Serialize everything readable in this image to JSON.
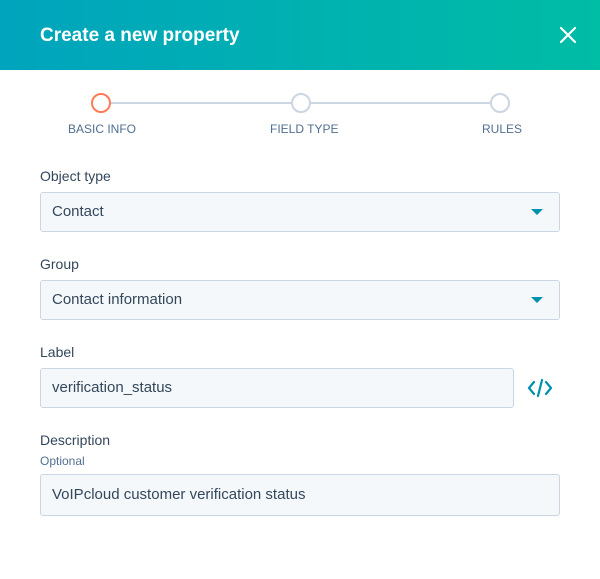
{
  "dialog": {
    "title": "Create a new property",
    "close_icon": "close-icon"
  },
  "stepper": {
    "steps": [
      {
        "label": "BASIC INFO",
        "state": "active"
      },
      {
        "label": "FIELD TYPE",
        "state": "inactive"
      },
      {
        "label": "RULES",
        "state": "inactive"
      }
    ]
  },
  "form": {
    "object_type": {
      "label": "Object type",
      "value": "Contact"
    },
    "group": {
      "label": "Group",
      "value": "Contact information"
    },
    "label_field": {
      "label": "Label",
      "value": "verification_status",
      "action_icon": "code-icon"
    },
    "description": {
      "label": "Description",
      "hint": "Optional",
      "value": "VoIPcloud customer verification status"
    }
  },
  "colors": {
    "header_start": "#00a4bd",
    "header_end": "#00bda5",
    "active_step": "#ff7a59",
    "accent": "#0091ae"
  }
}
